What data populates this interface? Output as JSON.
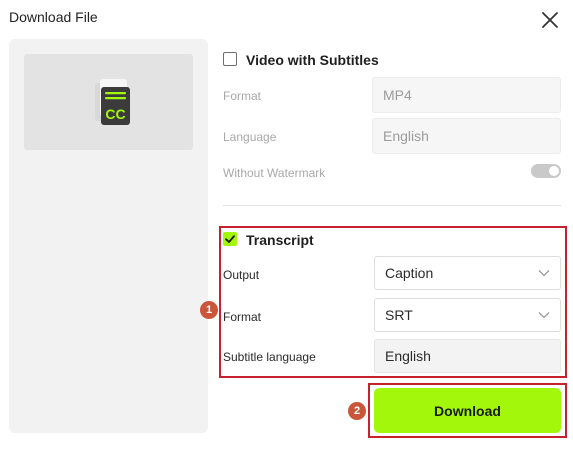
{
  "dialog": {
    "title": "Download File"
  },
  "icons": {
    "close": "close-icon",
    "thumbnail": "cc-subtitle-icon",
    "checkbox": "checkmark-icon",
    "dropdown": "chevron-down-icon"
  },
  "video_section": {
    "checked": false,
    "title": "Video with Subtitles",
    "format_label": "Format",
    "format_value": "MP4",
    "language_label": "Language",
    "language_value": "English",
    "watermark_label": "Without Watermark",
    "watermark_toggle_on": true
  },
  "transcript_section": {
    "checked": true,
    "title": "Transcript",
    "output_label": "Output",
    "output_value": "Caption",
    "format_label": "Format",
    "format_value": "SRT",
    "subtitle_language_label": "Subtitle language",
    "subtitle_language_value": "English"
  },
  "download_button": {
    "label": "Download"
  },
  "annotations": {
    "marker_1": "1",
    "marker_2": "2"
  },
  "colors": {
    "accent": "#a3f70a",
    "annotation_border": "#c7212d",
    "annotation_marker": "#c9563b"
  }
}
